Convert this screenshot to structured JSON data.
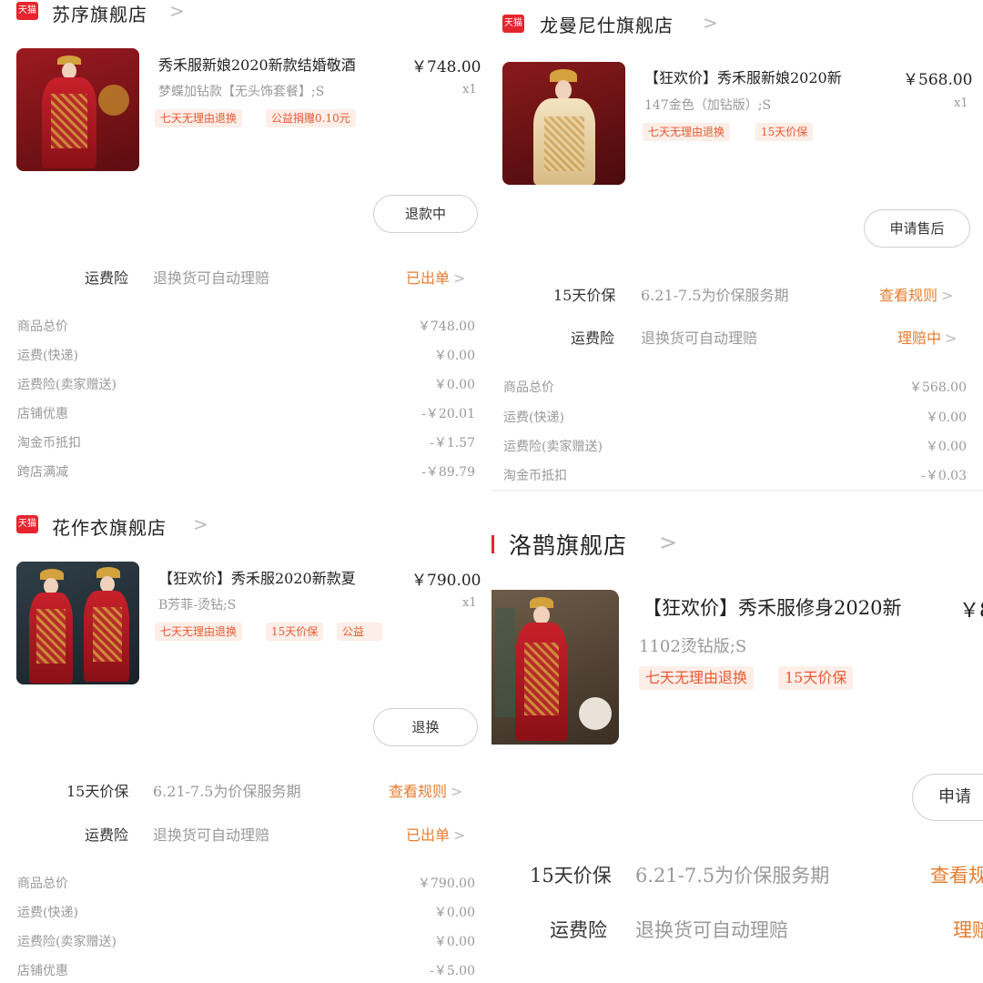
{
  "orders": [
    {
      "shop": "苏序旗舰店",
      "title": "秀禾服新娘2020新款结婚敬酒",
      "price": "￥748.00",
      "sku": "梦蝶加钻款【无头饰套餐】;S",
      "qty": "x1",
      "tags": [
        "七天无理由退换",
        "公益捐赠0.10元"
      ],
      "button": "退款中",
      "services": [
        {
          "label": "运费险",
          "desc": "退换货可自动理赔",
          "action": "已出单"
        }
      ],
      "summary": [
        {
          "label": "商品总价",
          "value": "￥748.00"
        },
        {
          "label": "运费(快递)",
          "value": "￥0.00"
        },
        {
          "label": "运费险(卖家赠送)",
          "value": "￥0.00"
        },
        {
          "label": "店铺优惠",
          "value": "-￥20.01"
        },
        {
          "label": "淘金币抵扣",
          "value": "-￥1.57"
        },
        {
          "label": "跨店满减",
          "value": "-￥89.79"
        }
      ]
    },
    {
      "shop": "龙曼尼仕旗舰店",
      "title": "【狂欢价】秀禾服新娘2020新",
      "price": "￥568.00",
      "sku": "147金色（加钻版）;S",
      "qty": "x1",
      "tags": [
        "七天无理由退换",
        "15天价保"
      ],
      "button": "申请售后",
      "services": [
        {
          "label": "15天价保",
          "desc": "6.21-7.5为价保服务期",
          "action": "查看规则"
        },
        {
          "label": "运费险",
          "desc": "退换货可自动理赔",
          "action": "理赔中"
        }
      ],
      "summary": [
        {
          "label": "商品总价",
          "value": "￥568.00"
        },
        {
          "label": "运费(快递)",
          "value": "￥0.00"
        },
        {
          "label": "运费险(卖家赠送)",
          "value": "￥0.00"
        },
        {
          "label": "淘金币抵扣",
          "value": "-￥0.03"
        }
      ]
    },
    {
      "shop": "花作衣旗舰店",
      "title": "【狂欢价】秀禾服2020新款夏",
      "price": "￥790.00",
      "sku": "B芳菲-烫钻;S",
      "qty": "x1",
      "tags": [
        "七天无理由退换",
        "15天价保",
        "公益"
      ],
      "button": "退换",
      "services": [
        {
          "label": "15天价保",
          "desc": "6.21-7.5为价保服务期",
          "action": "查看规则"
        },
        {
          "label": "运费险",
          "desc": "退换货可自动理赔",
          "action": "已出单"
        }
      ],
      "summary": [
        {
          "label": "商品总价",
          "value": "￥790.00"
        },
        {
          "label": "运费(快递)",
          "value": "￥0.00"
        },
        {
          "label": "运费险(卖家赠送)",
          "value": "￥0.00"
        },
        {
          "label": "店铺优惠",
          "value": "-￥5.00"
        }
      ]
    },
    {
      "shop": "洛鹊旗舰店",
      "title": "【狂欢价】秀禾服修身2020新",
      "price": "￥8",
      "sku": "1102烫钻版;S",
      "tags": [
        "七天无理由退换",
        "15天价保"
      ],
      "button": "申请",
      "services": [
        {
          "label": "15天价保",
          "desc": "6.21-7.5为价保服务期",
          "action": "查看规"
        },
        {
          "label": "运费险",
          "desc": "退换货可自动理赔",
          "action": "理赔"
        }
      ]
    }
  ],
  "badge": "天猫",
  "chevron": ">",
  "colors": {
    "accent": "#e87c2e",
    "tag_text": "#e85a33",
    "tag_bg": "#fdeee8",
    "tmall_red": "#e8252f"
  }
}
